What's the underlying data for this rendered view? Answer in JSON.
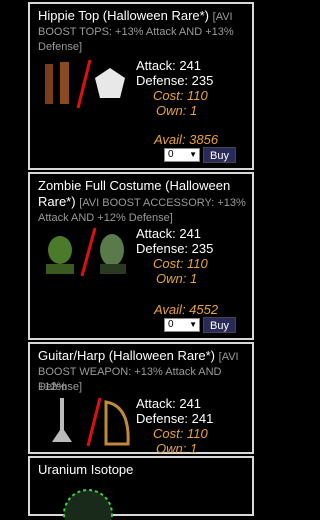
{
  "items": [
    {
      "title": "Hippie Top (Halloween Rare*)",
      "desc_inline": "[AVI",
      "desc_line1": "BOOST TOPS: +13% Attack AND +13%",
      "desc_line2": "Defense]",
      "attack": "Attack: 241",
      "defense": "Defense: 235",
      "cost": "Cost: 110",
      "own": "Own: 1",
      "avail": "Avail: 3856",
      "qty": "0",
      "buy": "Buy"
    },
    {
      "title": "Zombie Full Costume (Halloween",
      "title2": "Rare*)",
      "desc_inline": "[AVI BOOST ACCESSORY: +13%",
      "desc_line1": "Attack AND +12% Defense]",
      "attack": "Attack: 241",
      "defense": "Defense: 235",
      "cost": "Cost: 110",
      "own": "Own: 1",
      "avail": "Avail: 4552",
      "qty": "0",
      "buy": "Buy"
    },
    {
      "title": "Guitar/Harp (Halloween Rare*)",
      "desc_inline": "[AVI",
      "desc_line1": "BOOST WEAPON: +13% Attack AND +12%",
      "desc_line2": "Defense]",
      "attack": "Attack: 241",
      "defense": "Defense: 241",
      "cost": "Cost: 110",
      "own": "Own: 1"
    },
    {
      "title": "Uranium Isotope"
    }
  ]
}
